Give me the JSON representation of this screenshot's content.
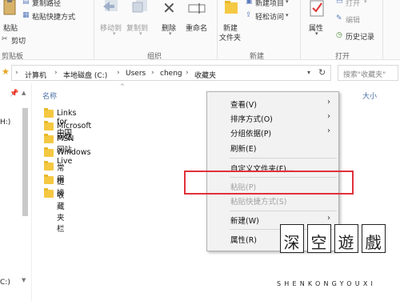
{
  "ribbon": {
    "clipboard": {
      "paste_label": "粘贴",
      "cut_label": "剪切",
      "copy_path_label": "复制路径",
      "paste_shortcut_label": "粘贴快捷方式",
      "group_label": "剪贴板"
    },
    "organize": {
      "move_to_label": "移动到",
      "copy_to_label": "复制到",
      "delete_label": "删除",
      "rename_label": "重命名",
      "group_label": "组织"
    },
    "new": {
      "new_folder_label_1": "新建",
      "new_folder_label_2": "文件夹",
      "new_item_label": "新建项目",
      "easy_access_label": "轻松访问",
      "group_label": "新建"
    },
    "open": {
      "properties_label": "属性",
      "open_label": "打开",
      "edit_label": "编辑",
      "history_label": "历史记录",
      "group_label": "打开"
    }
  },
  "address": {
    "crumbs": [
      "计算机",
      "本地磁盘 (C:)",
      "Users",
      "cheng",
      "收藏夹"
    ],
    "search_placeholder": "搜索\"收藏夹\""
  },
  "navpane": {
    "item_top": "H:)",
    "item_bottom": "C:)"
  },
  "columns": {
    "name": "名称",
    "size": "大小"
  },
  "files": [
    "Links for 中国",
    "Microsoft 网站",
    "MSN 网站",
    "Windows Live",
    "常用",
    "链接",
    "收藏夹栏"
  ],
  "context_menu": {
    "view": "查看(V)",
    "sort": "排序方式(O)",
    "group": "分组依据(P)",
    "refresh": "刷新(E)",
    "customize": "自定义文件夹(F)...",
    "paste": "粘贴(P)",
    "paste_shortcut": "粘贴快捷方式(S)",
    "new": "新建(W)",
    "properties": "属性(R)"
  },
  "watermark": {
    "chars": [
      "深",
      "空",
      "遊",
      "戲"
    ],
    "subtitle": "SHENKONGYOUXI"
  },
  "colors": {
    "highlight_border": "#e0313a",
    "folder_yellow": "#f5c842",
    "ribbon_bg": "#fafafa"
  }
}
